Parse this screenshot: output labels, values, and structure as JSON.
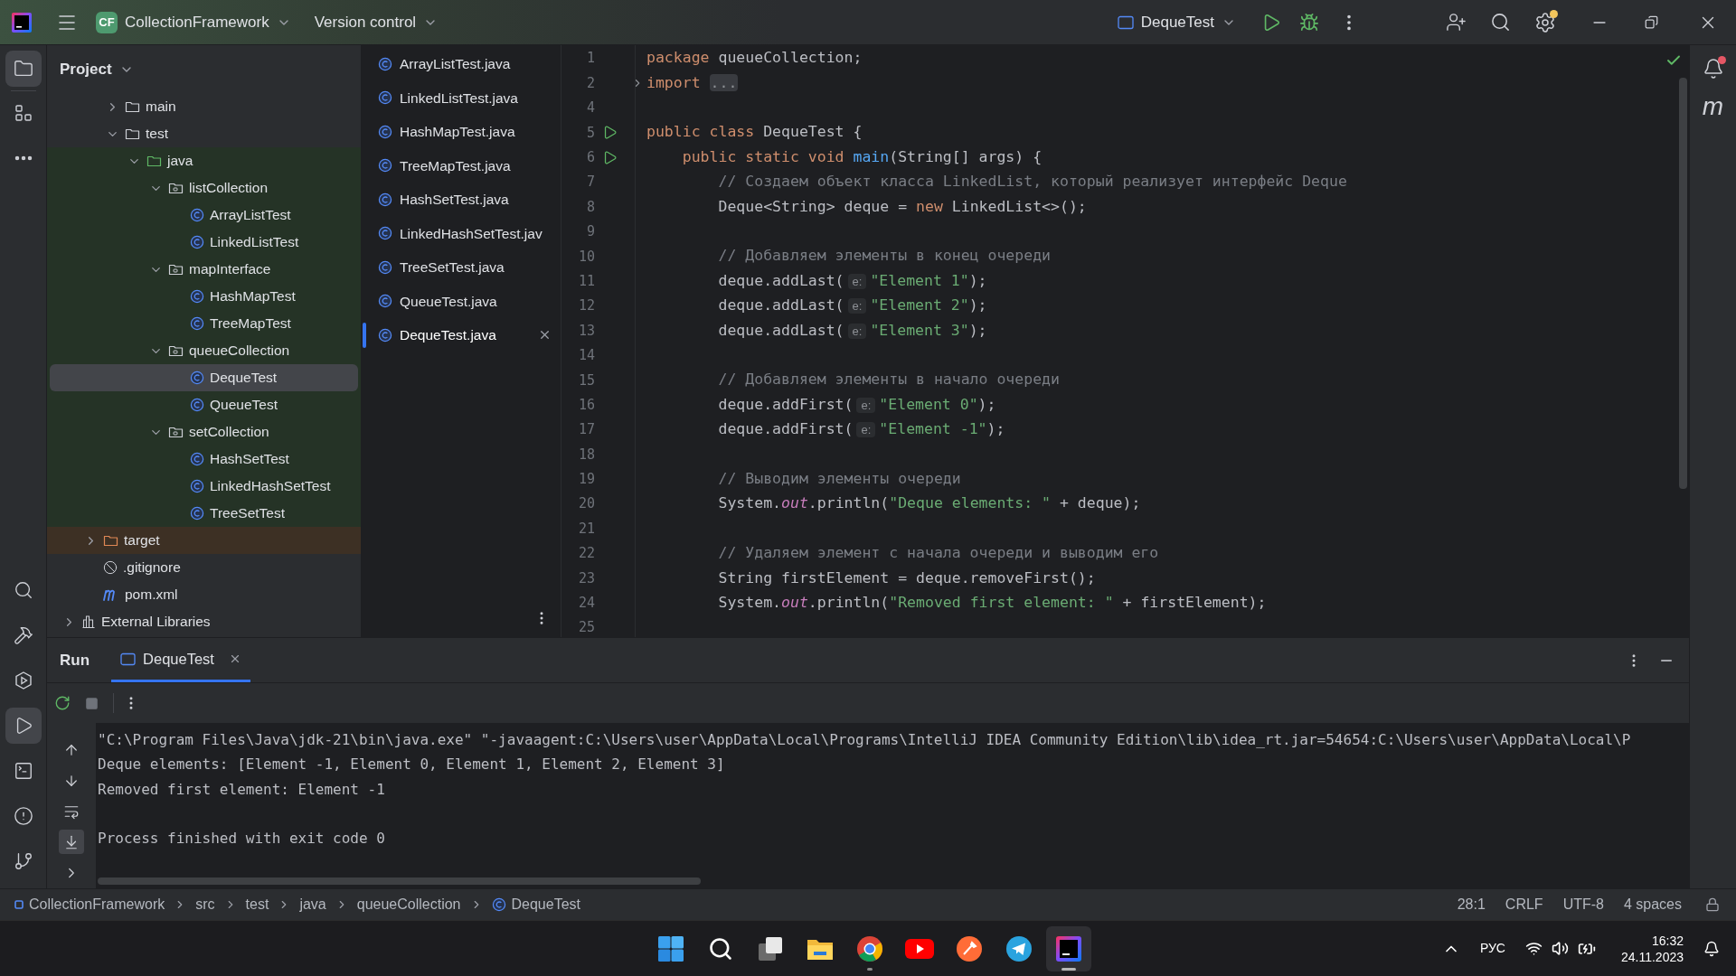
{
  "title_bar": {
    "project_badge": "CF",
    "project": "CollectionFramework",
    "vcs": "Version control",
    "run_config": "DequeTest"
  },
  "left_toolbar_top": [
    {
      "kind": "project",
      "selected": true
    },
    {
      "kind": "structure",
      "selected": false
    },
    {
      "kind": "more",
      "selected": false
    }
  ],
  "left_toolbar_bottom": [
    {
      "kind": "search",
      "selected": false
    },
    {
      "kind": "build",
      "selected": false
    },
    {
      "kind": "services",
      "selected": false
    },
    {
      "kind": "run",
      "selected": true
    },
    {
      "kind": "terminal",
      "selected": false
    },
    {
      "kind": "problems",
      "selected": false
    },
    {
      "kind": "git",
      "selected": false
    }
  ],
  "project_panel": {
    "title": "Project",
    "tree": [
      {
        "children": [
          {
            "children": [
              {
                "label": "main",
                "kind": "folder",
                "expanded": false
              },
              {
                "label": "test",
                "kind": "folder",
                "expanded": true,
                "children": [
                  {
                    "label": "java",
                    "kind": "source_folder",
                    "expanded": true,
                    "color": "#253326",
                    "children": [
                      {
                        "label": "listCollection",
                        "kind": "package",
                        "expanded": true,
                        "children": [
                          {
                            "label": "ArrayListTest",
                            "kind": "class",
                            "selected": false
                          },
                          {
                            "label": "LinkedListTest",
                            "kind": "class",
                            "selected": false
                          }
                        ]
                      },
                      {
                        "label": "mapInterface",
                        "kind": "package",
                        "expanded": true,
                        "children": [
                          {
                            "label": "HashMapTest",
                            "kind": "class",
                            "selected": false
                          },
                          {
                            "label": "TreeMapTest",
                            "kind": "class",
                            "selected": false
                          }
                        ]
                      },
                      {
                        "label": "queueCollection",
                        "kind": "package",
                        "expanded": true,
                        "children": [
                          {
                            "label": "DequeTest",
                            "kind": "class",
                            "selected": true
                          },
                          {
                            "label": "QueueTest",
                            "kind": "class",
                            "selected": false
                          }
                        ]
                      },
                      {
                        "label": "setCollection",
                        "kind": "package",
                        "expanded": true,
                        "children": [
                          {
                            "label": "HashSetTest",
                            "kind": "class",
                            "selected": false
                          },
                          {
                            "label": "LinkedHashSetTest",
                            "kind": "class",
                            "selected": false
                          },
                          {
                            "label": "TreeSetTest",
                            "kind": "class",
                            "selected": false
                          }
                        ]
                      }
                    ]
                  }
                ]
              }
            ]
          },
          {
            "label": "target",
            "kind": "excluded_folder",
            "expanded": false,
            "color": "#3d3024"
          },
          {
            "label": ".gitignore",
            "kind": "ignore_file"
          },
          {
            "label": "pom.xml",
            "kind": "maven_file"
          }
        ]
      },
      {
        "label": "External Libraries",
        "kind": "library",
        "expanded": false
      }
    ]
  },
  "editor_tabs": [
    {
      "label": "ArrayListTest.java",
      "selected": false
    },
    {
      "label": "LinkedListTest.java",
      "selected": false
    },
    {
      "label": "HashMapTest.java",
      "selected": false
    },
    {
      "label": "TreeMapTest.java",
      "selected": false
    },
    {
      "label": "HashSetTest.java",
      "selected": false
    },
    {
      "label": "LinkedHashSetTest.jav",
      "selected": false
    },
    {
      "label": "TreeSetTest.java",
      "selected": false
    },
    {
      "label": "QueueTest.java",
      "selected": false
    },
    {
      "label": "DequeTest.java",
      "selected": true
    }
  ],
  "editor": {
    "lines": [
      {
        "number": "1",
        "tokens": [
          {
            "kind": "keyword",
            "text": "package "
          },
          {
            "kind": "plain",
            "text": "queueCollection;"
          }
        ]
      },
      {
        "number": "2",
        "fold": true,
        "tokens": [
          {
            "kind": "keyword",
            "text": "import "
          },
          {
            "kind": "folded",
            "text": "..."
          }
        ]
      },
      {
        "number": "4"
      },
      {
        "number": "5",
        "run": true,
        "tokens": [
          {
            "kind": "keyword",
            "text": "public class "
          },
          {
            "kind": "plain",
            "text": "DequeTest {"
          }
        ]
      },
      {
        "number": "6",
        "run": true,
        "tokens": [
          {
            "kind": "keyword",
            "text": "    public static void "
          },
          {
            "kind": "declaration",
            "text": "main"
          },
          {
            "kind": "plain",
            "text": "(String[] args) {"
          }
        ]
      },
      {
        "number": "7",
        "tokens": [
          {
            "kind": "comment",
            "text": "        // Создаем объект класса LinkedList, который реализует интерфейс Deque"
          }
        ]
      },
      {
        "number": "8",
        "tokens": [
          {
            "kind": "plain",
            "text": "        Deque<String> deque = "
          },
          {
            "kind": "keyword",
            "text": "new "
          },
          {
            "kind": "plain",
            "text": "LinkedList<>();"
          }
        ]
      },
      {
        "number": "9"
      },
      {
        "number": "10",
        "tokens": [
          {
            "kind": "comment",
            "text": "        // Добавляем элементы в конец очереди"
          }
        ]
      },
      {
        "number": "11",
        "tokens": [
          {
            "kind": "plain",
            "text": "        deque.addLast("
          },
          {
            "kind": "hint",
            "text": "e:"
          },
          {
            "kind": "string",
            "text": "\"Element 1\""
          },
          {
            "kind": "plain",
            "text": ");"
          }
        ]
      },
      {
        "number": "12",
        "tokens": [
          {
            "kind": "plain",
            "text": "        deque.addLast("
          },
          {
            "kind": "hint",
            "text": "e:"
          },
          {
            "kind": "string",
            "text": "\"Element 2\""
          },
          {
            "kind": "plain",
            "text": ");"
          }
        ]
      },
      {
        "number": "13",
        "tokens": [
          {
            "kind": "plain",
            "text": "        deque.addLast("
          },
          {
            "kind": "hint",
            "text": "e:"
          },
          {
            "kind": "string",
            "text": "\"Element 3\""
          },
          {
            "kind": "plain",
            "text": ");"
          }
        ]
      },
      {
        "number": "14"
      },
      {
        "number": "15",
        "tokens": [
          {
            "kind": "comment",
            "text": "        // Добавляем элементы в начало очереди"
          }
        ]
      },
      {
        "number": "16",
        "tokens": [
          {
            "kind": "plain",
            "text": "        deque.addFirst("
          },
          {
            "kind": "hint",
            "text": "e:"
          },
          {
            "kind": "string",
            "text": "\"Element 0\""
          },
          {
            "kind": "plain",
            "text": ");"
          }
        ]
      },
      {
        "number": "17",
        "tokens": [
          {
            "kind": "plain",
            "text": "        deque.addFirst("
          },
          {
            "kind": "hint",
            "text": "e:"
          },
          {
            "kind": "string",
            "text": "\"Element -1\""
          },
          {
            "kind": "plain",
            "text": ");"
          }
        ]
      },
      {
        "number": "18"
      },
      {
        "number": "19",
        "tokens": [
          {
            "kind": "comment",
            "text": "        // Выводим элементы очереди"
          }
        ]
      },
      {
        "number": "20",
        "tokens": [
          {
            "kind": "plain",
            "text": "        System."
          },
          {
            "kind": "static_field",
            "text": "out"
          },
          {
            "kind": "plain",
            "text": ".println("
          },
          {
            "kind": "string",
            "text": "\"Deque elements: \""
          },
          {
            "kind": "plain",
            "text": " + deque);"
          }
        ]
      },
      {
        "number": "21"
      },
      {
        "number": "22",
        "tokens": [
          {
            "kind": "comment",
            "text": "        // Удаляем элемент с начала очереди и выводим его"
          }
        ]
      },
      {
        "number": "23",
        "tokens": [
          {
            "kind": "plain",
            "text": "        String firstElement = deque.removeFirst();"
          }
        ]
      },
      {
        "number": "24",
        "tokens": [
          {
            "kind": "plain",
            "text": "        System."
          },
          {
            "kind": "static_field",
            "text": "out"
          },
          {
            "kind": "plain",
            "text": ".println("
          },
          {
            "kind": "string",
            "text": "\"Removed first element: \""
          },
          {
            "kind": "plain",
            "text": " + firstElement);"
          }
        ]
      },
      {
        "number": "25"
      }
    ]
  },
  "right_strip": {
    "maven": "m"
  },
  "run_panel": {
    "title": "Run",
    "tabs": [
      {
        "label": "DequeTest",
        "selected": true
      }
    ],
    "side_tools": [
      {
        "kind": "up",
        "selected": false
      },
      {
        "kind": "down",
        "selected": false
      },
      {
        "kind": "wrap",
        "selected": false
      },
      {
        "kind": "scroll_end",
        "selected": true
      },
      {
        "kind": "expand",
        "selected": false
      }
    ],
    "output": [
      {
        "kind": "command",
        "text": "\"C:\\Program Files\\Java\\jdk-21\\bin\\java.exe\" \"-javaagent:C:\\Users\\user\\AppData\\Local\\Programs\\IntelliJ IDEA Community Edition\\lib\\idea_rt.jar=54654:C:\\Users\\user\\AppData\\Local\\P"
      },
      {
        "kind": "stdout",
        "text": "Deque elements: [Element -1, Element 0, Element 1, Element 2, Element 3]"
      },
      {
        "kind": "stdout",
        "text": "Removed first element: Element -1"
      },
      {
        "kind": "exit",
        "text": "Process finished with exit code 0"
      }
    ]
  },
  "status_bar": {
    "breadcrumbs": [
      {
        "label": "CollectionFramework",
        "kind": "module"
      },
      {
        "label": "src",
        "kind": "plain"
      },
      {
        "label": "test",
        "kind": "plain"
      },
      {
        "label": "java",
        "kind": "plain"
      },
      {
        "label": "queueCollection",
        "kind": "plain"
      },
      {
        "label": "DequeTest",
        "kind": "class"
      }
    ],
    "items": [
      "28:1",
      "CRLF",
      "UTF-8",
      "4 spaces"
    ]
  },
  "taskbar": {
    "apps": [
      {
        "kind": "start",
        "running": false,
        "selected": false
      },
      {
        "kind": "search",
        "running": false,
        "selected": false
      },
      {
        "kind": "taskview",
        "running": false,
        "selected": false
      },
      {
        "kind": "explorer",
        "running": false,
        "selected": false
      },
      {
        "kind": "browser",
        "running": true,
        "selected": false
      },
      {
        "kind": "video",
        "running": false,
        "selected": false
      },
      {
        "kind": "api",
        "running": false,
        "selected": false
      },
      {
        "kind": "messenger",
        "running": false,
        "selected": false
      },
      {
        "kind": "ide",
        "running": true,
        "selected": true
      }
    ],
    "language": "РУС",
    "time": "16:32",
    "date": "24.11.2023"
  }
}
